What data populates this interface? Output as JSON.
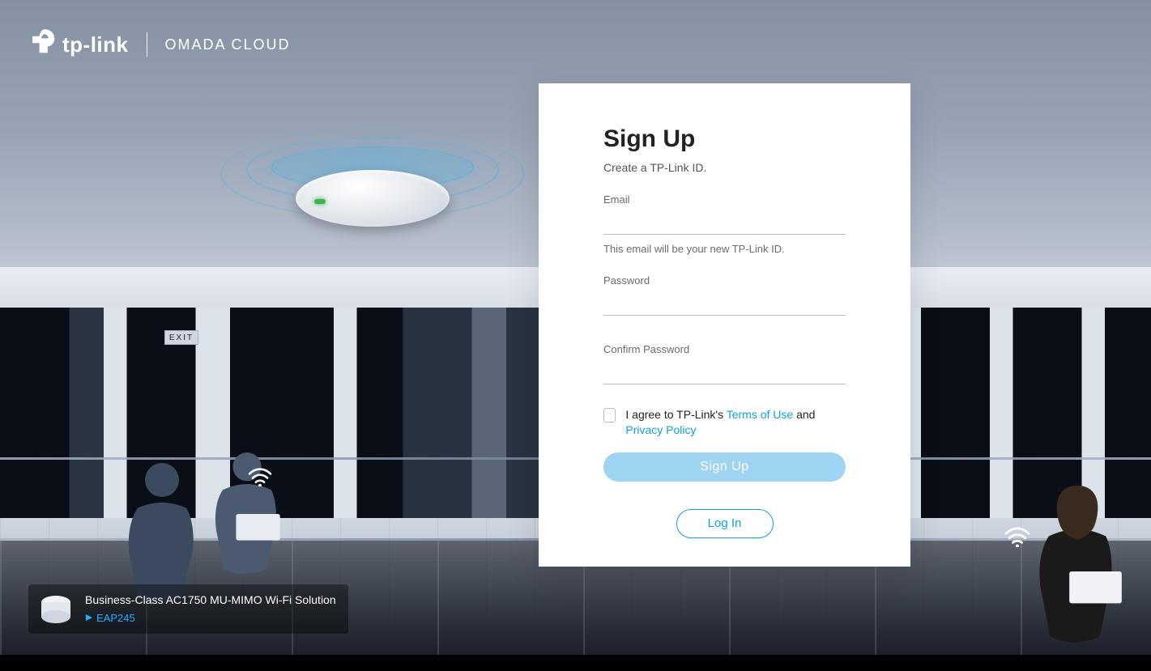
{
  "brand": {
    "name": "tp-link",
    "product": "OMADA CLOUD"
  },
  "callout": {
    "title": "Business-Class AC1750 MU-MIMO Wi-Fi Solution",
    "link_label": "EAP245"
  },
  "signup": {
    "title": "Sign Up",
    "subtitle": "Create a TP-Link ID.",
    "email_label": "Email",
    "email_value": "",
    "email_help": "This email will be your new TP-Link ID.",
    "password_label": "Password",
    "password_value": "",
    "confirm_label": "Confirm Password",
    "confirm_value": "",
    "agree_prefix": "I agree to TP-Link's ",
    "terms_label": "Terms of Use",
    "agree_mid": " and ",
    "privacy_label": "Privacy Policy",
    "submit_label": "Sign Up",
    "login_label": "Log In"
  },
  "scene": {
    "exit_label": "EXIT"
  }
}
